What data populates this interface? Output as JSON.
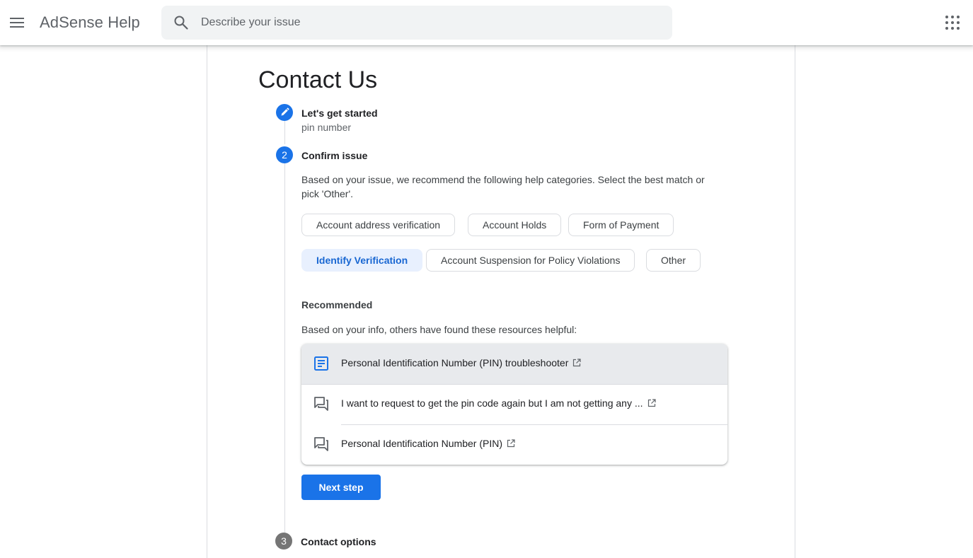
{
  "header": {
    "app_title": "AdSense Help",
    "search_placeholder": "Describe your issue"
  },
  "main": {
    "page_title": "Contact Us",
    "steps": [
      {
        "number": "",
        "title": "Let's get started",
        "subtitle": "pin number",
        "state": "completed"
      },
      {
        "number": "2",
        "title": "Confirm issue",
        "state": "active"
      },
      {
        "number": "3",
        "title": "Contact options",
        "state": "upcoming"
      }
    ],
    "confirm_description": "Based on your issue, we recommend the following help categories. Select the best match or pick 'Other'.",
    "categories": [
      {
        "label": "Account address verification",
        "selected": false
      },
      {
        "label": "Account Holds",
        "selected": false
      },
      {
        "label": "Form of Payment",
        "selected": false
      },
      {
        "label": "Identify Verification",
        "selected": true
      },
      {
        "label": "Account Suspension for Policy Violations",
        "selected": false
      },
      {
        "label": "Other",
        "selected": false
      }
    ],
    "recommended": {
      "title": "Recommended",
      "description": "Based on your info, others have found these resources helpful:",
      "items": [
        {
          "label": "Personal Identification Number (PIN) troubleshooter",
          "icon": "article-icon"
        },
        {
          "label": "I want to request to get the pin code again but I am not getting any ...",
          "icon": "forum-icon"
        },
        {
          "label": "Personal Identification Number (PIN)",
          "icon": "forum-icon"
        }
      ]
    },
    "next_button_label": "Next step"
  },
  "colors": {
    "accent": "#1a73e8",
    "selected_chip_bg": "#e8f0fe",
    "selected_chip_text": "#1967d2",
    "upcoming_step": "#757575"
  }
}
